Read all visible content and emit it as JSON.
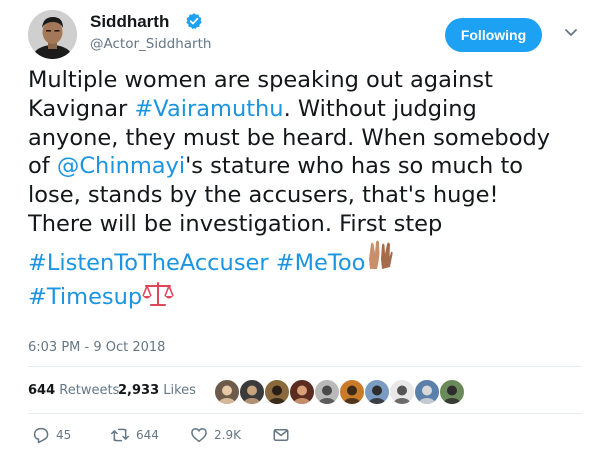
{
  "user": {
    "display_name": "Siddharth",
    "handle": "@Actor_Siddharth",
    "verified_icon": "verified-badge-icon",
    "follow_label": "Following"
  },
  "tweet": {
    "lines": [
      [
        {
          "t": "Multiple women are speaking out against"
        }
      ],
      [
        {
          "t": "Kavignar "
        },
        {
          "t": "#Vairamuthu",
          "link": true
        },
        {
          "t": ". Without judging"
        }
      ],
      [
        {
          "t": "anyone, they must be heard. When somebody"
        }
      ],
      [
        {
          "t": "of "
        },
        {
          "t": "@Chinmayi",
          "link": true
        },
        {
          "t": "'s stature who has so much to"
        }
      ],
      [
        {
          "t": "lose, stands by the accusers, that's huge!"
        }
      ],
      [
        {
          "t": "There will be investigation. First step"
        }
      ],
      [
        {
          "t": "#ListenToTheAccuser",
          "link": true
        },
        {
          "t": " "
        },
        {
          "t": "#MeToo",
          "link": true
        },
        {
          "emoji": "raised-hands-icon"
        }
      ],
      [
        {
          "t": "#Timesup",
          "link": true
        },
        {
          "emoji": "scales-icon"
        }
      ]
    ],
    "timestamp": "6:03 PM - 9 Oct 2018"
  },
  "stats": {
    "retweets_count": "644",
    "retweets_label": "Retweets",
    "likes_count": "2,933",
    "likes_label": "Likes",
    "likers": [
      {
        "bg": "#6d5a4a",
        "fg": "#e8c9a5"
      },
      {
        "bg": "#3b3b3b",
        "fg": "#c9a27e"
      },
      {
        "bg": "#8a6a3c",
        "fg": "#2b1e14"
      },
      {
        "bg": "#5b2d20",
        "fg": "#d7a078"
      },
      {
        "bg": "#b9b9b9",
        "fg": "#4a4a4a"
      },
      {
        "bg": "#c97b2a",
        "fg": "#3d2a1a"
      },
      {
        "bg": "#7a9cc2",
        "fg": "#2e2e2e"
      },
      {
        "bg": "#e8e8e8",
        "fg": "#555555"
      },
      {
        "bg": "#5a7fa8",
        "fg": "#d8d8d8"
      },
      {
        "bg": "#6b8a5a",
        "fg": "#2d2d2d"
      }
    ]
  },
  "actions": {
    "reply_count": "45",
    "retweet_count": "644",
    "like_count": "2.9K"
  },
  "colors": {
    "link": "#1b95e0",
    "accent": "#1da1f2",
    "muted": "#657786"
  }
}
